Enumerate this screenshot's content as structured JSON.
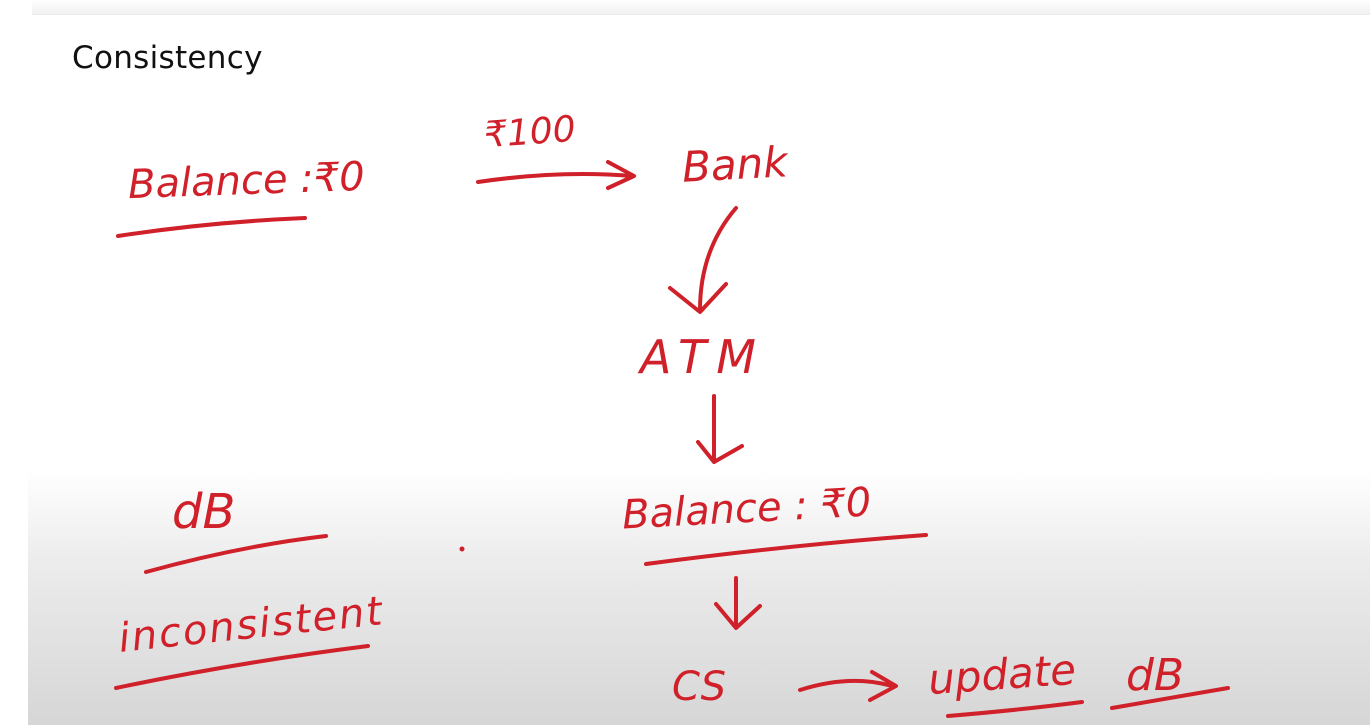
{
  "title": "Consistency",
  "ink_color": "#d0202a",
  "labels": {
    "balance_before": "Balance :₹0",
    "amount": "₹100",
    "bank": "Bank",
    "atm": "ATM",
    "balance_after": "Balance : ₹0",
    "db_left": "dB",
    "inconsistent": "inconsistent",
    "cs": "CS",
    "update": "update",
    "db_right": "dB"
  }
}
